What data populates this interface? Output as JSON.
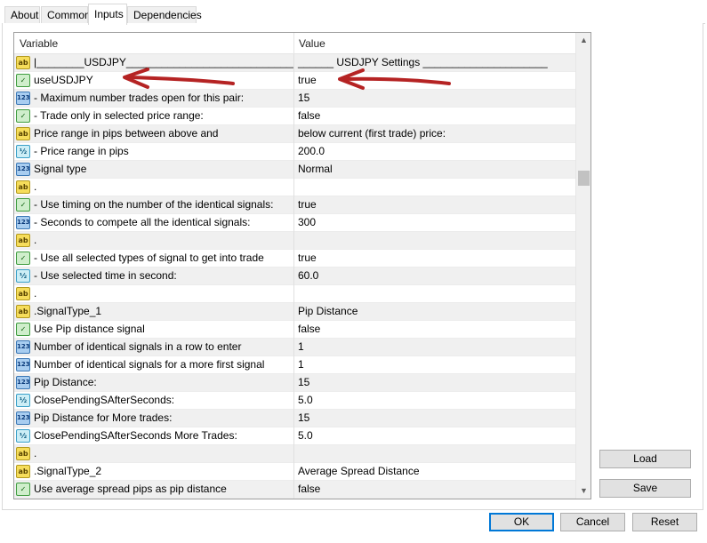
{
  "tabs": [
    "About",
    "Common",
    "Inputs",
    "Dependencies"
  ],
  "active_tab": "Inputs",
  "grid": {
    "columns": {
      "variable": "Variable",
      "value": "Value"
    },
    "rows": [
      {
        "type": "ab",
        "variable": "|________USDJPY_______________________________...",
        "value": "______ USDJPY Settings _____________________"
      },
      {
        "type": "bool",
        "variable": "useUSDJPY",
        "value": "true"
      },
      {
        "type": "n123",
        "variable": " - Maximum number trades open for this pair:",
        "value": "15"
      },
      {
        "type": "bool",
        "variable": " - Trade only in selected price range:",
        "value": "false"
      },
      {
        "type": "ab",
        "variable": "Price range in pips between above and",
        "value": "below current (first trade) price:"
      },
      {
        "type": "dbl",
        "variable": " - Price range in pips",
        "value": "200.0"
      },
      {
        "type": "n123",
        "variable": "Signal type",
        "value": "Normal"
      },
      {
        "type": "ab",
        "variable": ".",
        "value": ""
      },
      {
        "type": "bool",
        "variable": " - Use timing on the number of the identical signals:",
        "value": "true"
      },
      {
        "type": "n123",
        "variable": " - Seconds to compete all the identical signals:",
        "value": "300"
      },
      {
        "type": "ab",
        "variable": ".",
        "value": ""
      },
      {
        "type": "bool",
        "variable": " - Use all selected types of signal to get into trade",
        "value": "true"
      },
      {
        "type": "dbl",
        "variable": " - Use selected time in second:",
        "value": "60.0"
      },
      {
        "type": "ab",
        "variable": ".",
        "value": ""
      },
      {
        "type": "ab",
        "variable": ".SignalType_1",
        "value": "Pip Distance"
      },
      {
        "type": "bool",
        "variable": "Use Pip distance signal",
        "value": "false"
      },
      {
        "type": "n123",
        "variable": "Number of identical signals in a row to enter",
        "value": "1"
      },
      {
        "type": "n123",
        "variable": "Number of identical signals for a more first signal",
        "value": "1"
      },
      {
        "type": "n123",
        "variable": "Pip Distance:",
        "value": "15"
      },
      {
        "type": "dbl",
        "variable": "ClosePendingSAfterSeconds:",
        "value": "5.0"
      },
      {
        "type": "n123",
        "variable": "Pip Distance for More trades:",
        "value": "15"
      },
      {
        "type": "dbl",
        "variable": "ClosePendingSAfterSeconds More Trades:",
        "value": "5.0"
      },
      {
        "type": "ab",
        "variable": ".",
        "value": ""
      },
      {
        "type": "ab",
        "variable": ".SignalType_2",
        "value": "Average Spread Distance"
      },
      {
        "type": "bool",
        "variable": "Use average spread pips as pip distance",
        "value": "false"
      }
    ]
  },
  "icon_names": {
    "ab": "string-icon",
    "bool": "boolean-icon",
    "n123": "integer-icon",
    "dbl": "double-icon"
  },
  "icon_glyphs": {
    "ab": "ab",
    "bool": "✓",
    "n123": "123",
    "dbl": "½"
  },
  "side_buttons": {
    "load": "Load",
    "save": "Save"
  },
  "bottom_buttons": {
    "ok": "OK",
    "cancel": "Cancel",
    "reset": "Reset"
  },
  "colors": {
    "annotation_arrow": "#b52323",
    "default_button_border": "#0078d7"
  }
}
